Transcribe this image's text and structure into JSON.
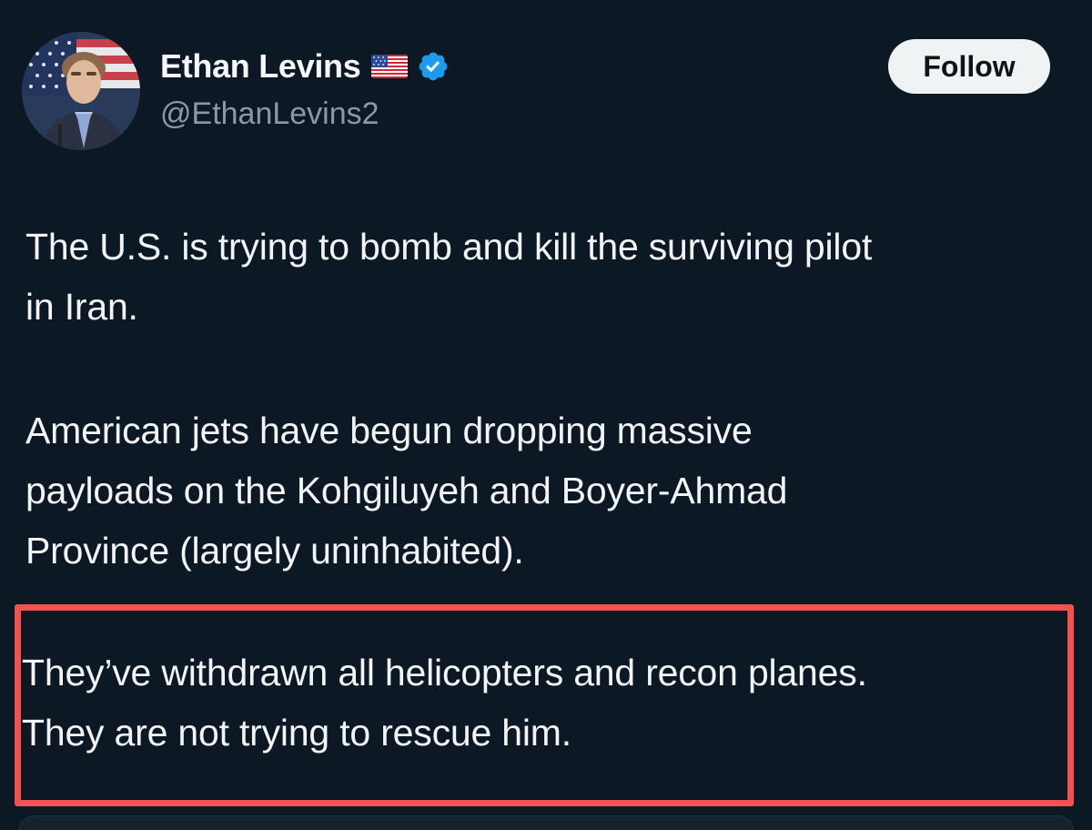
{
  "author": {
    "display_name": "Ethan Levins",
    "flag_icon": "us-flag-icon",
    "verified_icon": "verified-badge-icon",
    "verified_color": "#1d9bf0",
    "handle": "@EthanLevins2"
  },
  "actions": {
    "follow_label": "Follow"
  },
  "post": {
    "paragraph_1": "The U.S. is trying to bomb and kill the surviving pilot\nin Iran.",
    "paragraph_2": "American jets have begun dropping massive\npayloads on the Kohgiluyeh and Boyer-Ahmad\nProvince (largely uninhabited).",
    "paragraph_3": "They’ve withdrawn all helicopters and recon planes.\nThey are not trying to rescue him."
  },
  "colors": {
    "background": "#0c1823",
    "highlight_border": "#f0524f",
    "follow_button_bg": "#eff3f4",
    "handle_text": "#8b98a5"
  }
}
